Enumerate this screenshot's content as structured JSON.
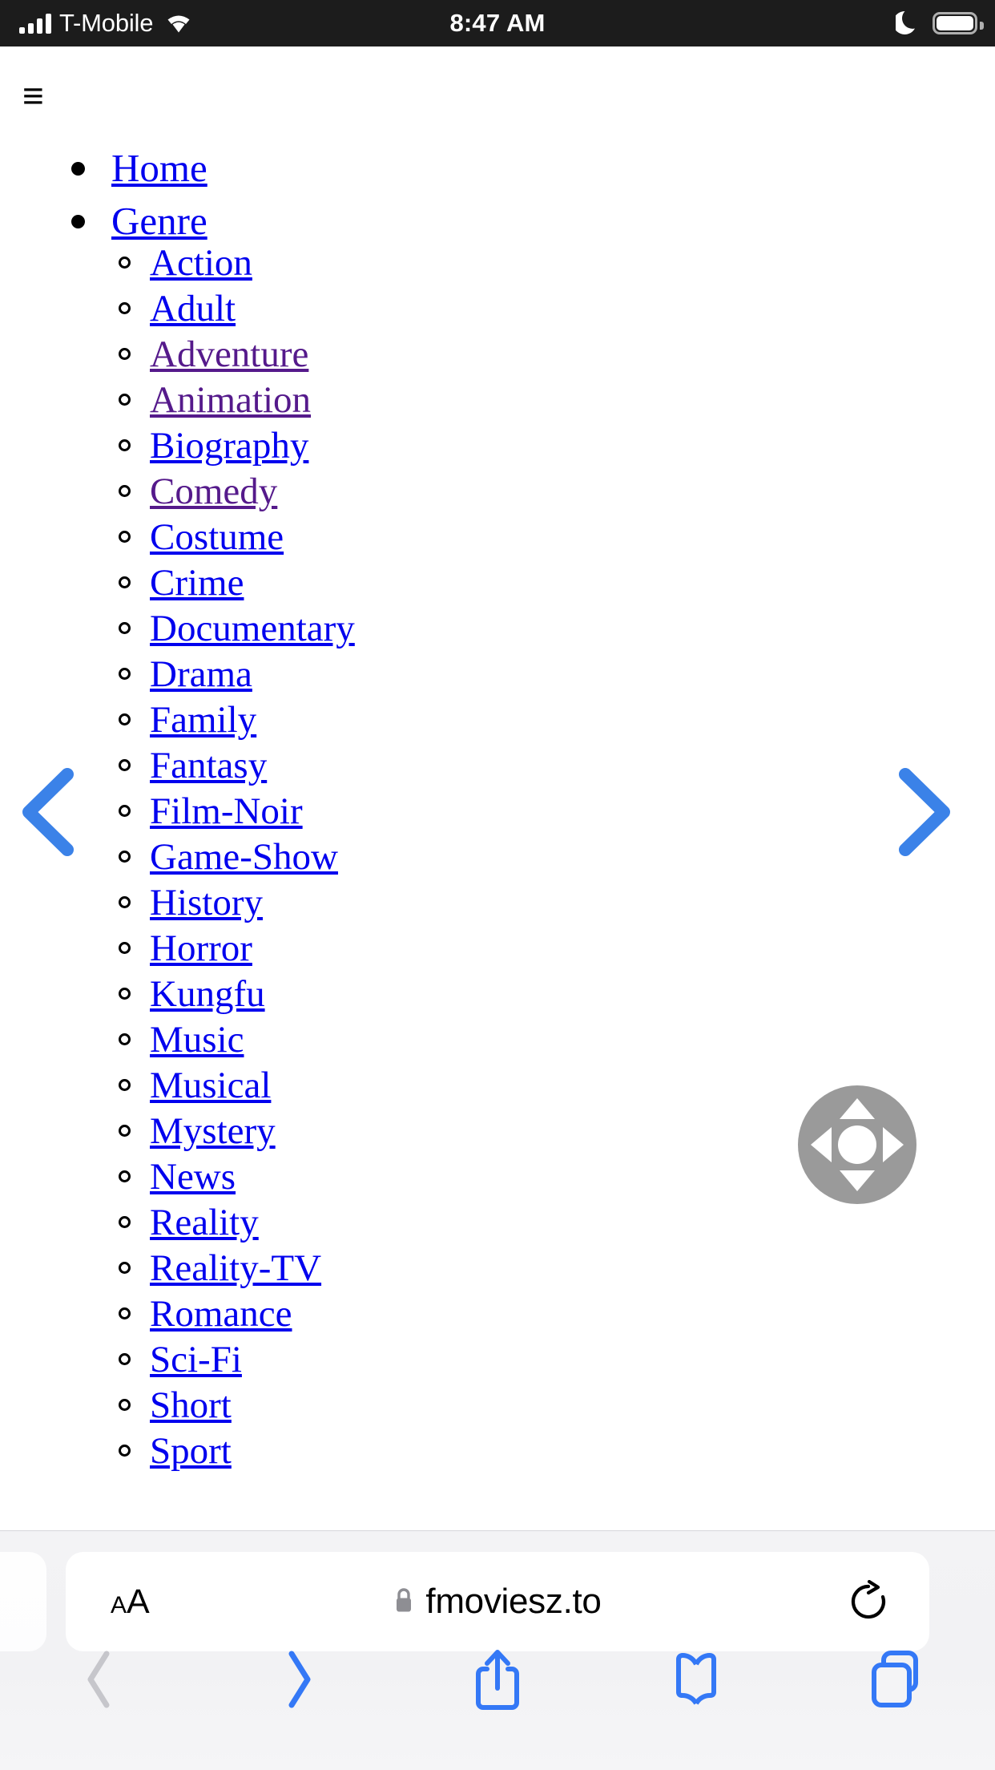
{
  "status_bar": {
    "carrier": "T-Mobile",
    "time": "8:47 AM",
    "signal_bars": 4,
    "wifi_icon": "wifi-icon",
    "dnd_icon": "moon-icon",
    "battery_icon": "battery-full-icon"
  },
  "page": {
    "hamburger_glyph": "≡",
    "nav": [
      {
        "label": "Home",
        "state": "unvisited"
      },
      {
        "label": "Genre",
        "state": "unvisited"
      }
    ],
    "genres": [
      {
        "label": "Action",
        "state": "unvisited"
      },
      {
        "label": "Adult",
        "state": "unvisited"
      },
      {
        "label": "Adventure",
        "state": "visited"
      },
      {
        "label": "Animation",
        "state": "visited"
      },
      {
        "label": "Biography",
        "state": "unvisited"
      },
      {
        "label": "Comedy",
        "state": "visited"
      },
      {
        "label": "Costume",
        "state": "unvisited"
      },
      {
        "label": "Crime",
        "state": "unvisited"
      },
      {
        "label": "Documentary",
        "state": "unvisited"
      },
      {
        "label": "Drama",
        "state": "unvisited"
      },
      {
        "label": "Family",
        "state": "unvisited"
      },
      {
        "label": "Fantasy",
        "state": "unvisited"
      },
      {
        "label": "Film-Noir",
        "state": "unvisited"
      },
      {
        "label": "Game-Show",
        "state": "unvisited"
      },
      {
        "label": "History",
        "state": "unvisited"
      },
      {
        "label": "Horror",
        "state": "unvisited"
      },
      {
        "label": "Kungfu",
        "state": "unvisited"
      },
      {
        "label": "Music",
        "state": "unvisited"
      },
      {
        "label": "Musical",
        "state": "unvisited"
      },
      {
        "label": "Mystery",
        "state": "unvisited"
      },
      {
        "label": "News",
        "state": "unvisited"
      },
      {
        "label": "Reality",
        "state": "unvisited"
      },
      {
        "label": "Reality-TV",
        "state": "unvisited"
      },
      {
        "label": "Romance",
        "state": "unvisited"
      },
      {
        "label": "Sci-Fi",
        "state": "unvisited"
      },
      {
        "label": "Short",
        "state": "unvisited"
      },
      {
        "label": "Sport",
        "state": "unvisited"
      }
    ]
  },
  "overlay": {
    "prev_icon": "chevron-left-icon",
    "next_icon": "chevron-right-icon",
    "dpad_icon": "dpad-icon",
    "accent_color": "#3b82e8",
    "dpad_color": "#9a9a9a"
  },
  "browser": {
    "text_size_small": "A",
    "text_size_large": "A",
    "lock_icon": "lock-icon",
    "url": "fmoviesz.to",
    "reload_icon": "reload-icon",
    "toolbar": [
      {
        "name": "back",
        "icon": "chevron-left-icon",
        "enabled": false
      },
      {
        "name": "forward",
        "icon": "chevron-right-icon",
        "enabled": true
      },
      {
        "name": "share",
        "icon": "share-icon",
        "enabled": true
      },
      {
        "name": "bookmarks",
        "icon": "book-icon",
        "enabled": true
      },
      {
        "name": "tabs",
        "icon": "tabs-icon",
        "enabled": true
      }
    ],
    "accent_color": "#3478f6",
    "disabled_color": "#c6c6cb"
  }
}
